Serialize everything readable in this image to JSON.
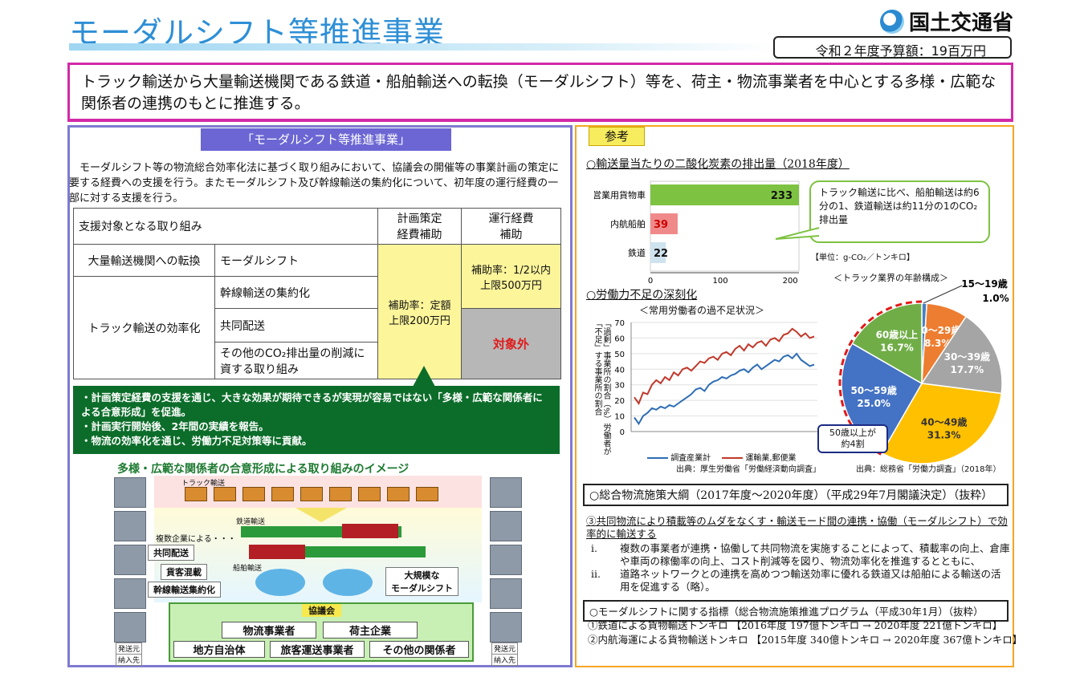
{
  "header": {
    "title": "モーダルシフト等推進事業",
    "ministry": "国土交通省",
    "budget": "令和２年度予算額：19百万円"
  },
  "banner": "トラック輸送から大量輸送機関である鉄道・船舶輸送への転換（モーダルシフト）等を、荷主・物流事業者を中心とする多様・広範な関係者の連携のもとに推進する。",
  "left": {
    "heading": "「モーダルシフト等推進事業」",
    "description": "モーダルシフト等の物流総合効率化法に基づく取り組みにおいて、協議会の開催等の事業計画の策定に要する経費への支援を行う。またモーダルシフト及び幹線輸送の集約化について、初年度の運行経費の一部に対する支援を行う。",
    "table": {
      "h_target": "支援対象となる取り組み",
      "h_plan": "計画策定\n経費補助",
      "h_op": "運行経費\n補助",
      "r1_a": "大量輸送機関への転換",
      "r1_b": "モーダルシフト",
      "r2_a": "トラック輸送の効率化",
      "r2_b": "幹線輸送の集約化",
      "r3_b": "共同配送",
      "r4_b": "その他のCO₂排出量の削減に資する取り組み",
      "plan_rate": "補助率：定額\n上限200万円",
      "op_rate": "補助率：1/2以内\n上限500万円",
      "op_excluded": "対象外"
    },
    "bullets": [
      "・計画策定経費の支援を通じ、大きな効果が期待できるが実現が容易ではない「多様・広範な関係者による合意形成」を促進。",
      "・計画実行開始後、2年間の実績を報告。",
      "・物流の効率化を通じ、労働力不足対策等に貢献。"
    ],
    "image_title": "多様・広範な関係者の合意形成による取り組みのイメージ",
    "illus": {
      "truck": "トラック輸送",
      "rail": "鉄道輸送",
      "ship": "船舶輸送",
      "companies": "複数企業による・・・",
      "joint": "共同配送",
      "mixed": "貨客混載",
      "trunk": "幹線輸送集約化",
      "modal": "大規模な\nモーダルシフト",
      "council": "協議会",
      "c1": "物流事業者",
      "c2": "荷主企業",
      "c3": "地方自治体",
      "c4": "旅客運送事業者",
      "c5": "その他の関係者",
      "origin": "発送元",
      "dest": "納入先"
    }
  },
  "right": {
    "ref": "参考",
    "co2_title": "○輸送量当たりの二酸化炭素の排出量（2018年度）",
    "bubble": "トラック輸送に比べ、船舶輸送は約6分の1、鉄道輸送は約11分の1のCO₂排出量",
    "unit": "【単位：g-CO₂／トンキロ】",
    "labor_title": "○労働力不足の深刻化",
    "labor_sub": "＜常用労働者の過不足状況＞",
    "labor_ylabel": "「過剰」事業所の割合（%）労働者が「不足」する事業所の割合",
    "labor_legend1": "調査産業計",
    "labor_legend2": "運輸業,郵便業",
    "labor_source": "出典：厚生労働省「労働経済動向調査」",
    "pie_title": "＜トラック業界の年齢構成＞",
    "pie_note": "50歳以上が\n約4割",
    "pie_source": "出典：総務省「労働力調査」（2018年）",
    "outline_title": "○総合物流施策大綱（2017年度～2020年度）（平成29年7月閣議決定）（抜粋）",
    "outline_item": "③共同物流により積載等のムダをなくす・輸送モード間の連携・協働（モーダルシフト）で効率的に輸送する",
    "outline_i": "複数の事業者が連携・協働して共同物流を実施することによって、積載率の向上、倉庫や車両の稼働率の向上、コスト削減等を図り、物流効率化を推進するとともに、",
    "outline_ii": "道路ネットワークとの連携を高めつつ輸送効率に優れる鉄道又は船舶による輸送の活用を促進する（略）。",
    "roman_i": "i.",
    "roman_ii": "ii.",
    "index_title": "○モーダルシフトに関する指標（総合物流施策推進プログラム（平成30年1月）（抜粋）",
    "index_1": "①鉄道による貨物輸送トンキロ 【2016年度 197億トンキロ → 2020年度 221億トンキロ】",
    "index_2": "②内航海運による貨物輸送トンキロ 【2015年度 340億トンキロ → 2020年度 367億トンキロ】"
  },
  "chart_data": [
    {
      "type": "bar",
      "title": "○輸送量当たりの二酸化炭素の排出量（2018年度）",
      "categories": [
        "営業用貨物車",
        "内航船舶",
        "鉄道"
      ],
      "values": [
        233,
        39,
        22
      ],
      "xlim": [
        0,
        200
      ],
      "xticks": [
        "0",
        "100",
        "200"
      ],
      "colors": [
        "#7dc241",
        "#f08a8a",
        "#cfe3ee"
      ]
    },
    {
      "type": "line",
      "title": "＜常用労働者の過不足状況＞",
      "ylim": [
        0,
        70
      ],
      "yticks": [
        "0",
        "10",
        "20",
        "30",
        "40",
        "50",
        "60",
        "70"
      ],
      "series": [
        {
          "name": "調査産業計",
          "color": "#2e6db4",
          "values": [
            9,
            5,
            10,
            12,
            15,
            14,
            16,
            15,
            17,
            16,
            18,
            20,
            22,
            24,
            27,
            28,
            26,
            30,
            32,
            33,
            35,
            34,
            36,
            37,
            39,
            40,
            38,
            41,
            43,
            40,
            42,
            44,
            46,
            45,
            48,
            49,
            47,
            50,
            46,
            44,
            42,
            43
          ]
        },
        {
          "name": "運輸業,郵便業",
          "color": "#c0392b",
          "values": [
            22,
            18,
            25,
            24,
            30,
            33,
            31,
            35,
            33,
            38,
            36,
            40,
            41,
            39,
            42,
            45,
            44,
            47,
            48,
            46,
            50,
            51,
            49,
            53,
            55,
            52,
            56,
            54,
            57,
            58,
            55,
            59,
            60,
            58,
            62,
            63,
            66,
            64,
            61,
            63,
            60,
            61
          ]
        }
      ]
    },
    {
      "type": "pie",
      "title": "＜トラック業界の年齢構成＞",
      "slices": [
        {
          "label": "15～19歳",
          "value": 1.0,
          "color": "#4a7fc1"
        },
        {
          "label": "20～29歳",
          "value": 8.3,
          "color": "#ed7d31"
        },
        {
          "label": "30～39歳",
          "value": 17.7,
          "color": "#a5a5a5"
        },
        {
          "label": "40～49歳",
          "value": 31.3,
          "color": "#ffc000"
        },
        {
          "label": "50～59歳",
          "value": 25.0,
          "color": "#4472c4"
        },
        {
          "label": "60歳以上",
          "value": 16.7,
          "color": "#70ad47"
        }
      ],
      "value_labels": [
        "1.0%",
        "8.3%",
        "17.7%",
        "31.3%",
        "25.0%",
        "16.7%"
      ]
    }
  ]
}
